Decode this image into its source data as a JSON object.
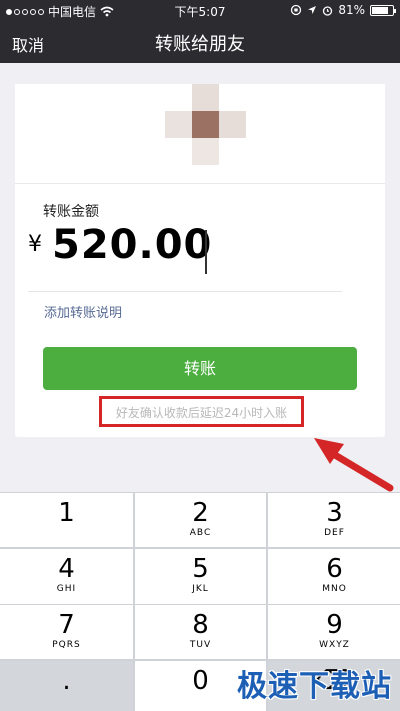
{
  "status_bar": {
    "carrier": "中国电信",
    "time": "下午5:07",
    "battery": "81%",
    "battery_level": 0.81
  },
  "nav": {
    "cancel": "取消",
    "title": "转账给朋友"
  },
  "transfer": {
    "amount_label": "转账金额",
    "currency_symbol": "¥",
    "amount": "520.00",
    "add_note": "添加转账说明",
    "submit": "转账",
    "hint": "好友确认收款后延迟24小时入账"
  },
  "keypad": {
    "keys": [
      {
        "num": "1",
        "letters": ""
      },
      {
        "num": "2",
        "letters": "ABC"
      },
      {
        "num": "3",
        "letters": "DEF"
      },
      {
        "num": "4",
        "letters": "GHI"
      },
      {
        "num": "5",
        "letters": "JKL"
      },
      {
        "num": "6",
        "letters": "MNO"
      },
      {
        "num": "7",
        "letters": "PQRS"
      },
      {
        "num": "8",
        "letters": "TUV"
      },
      {
        "num": "9",
        "letters": "WXYZ"
      },
      {
        "num": ".",
        "letters": ""
      },
      {
        "num": "0",
        "letters": ""
      },
      {
        "num": "⌫",
        "letters": ""
      }
    ]
  },
  "watermark": "极速下载站",
  "colors": {
    "accent": "#4cae3f",
    "annotation": "#d42626",
    "link": "#576b95"
  }
}
